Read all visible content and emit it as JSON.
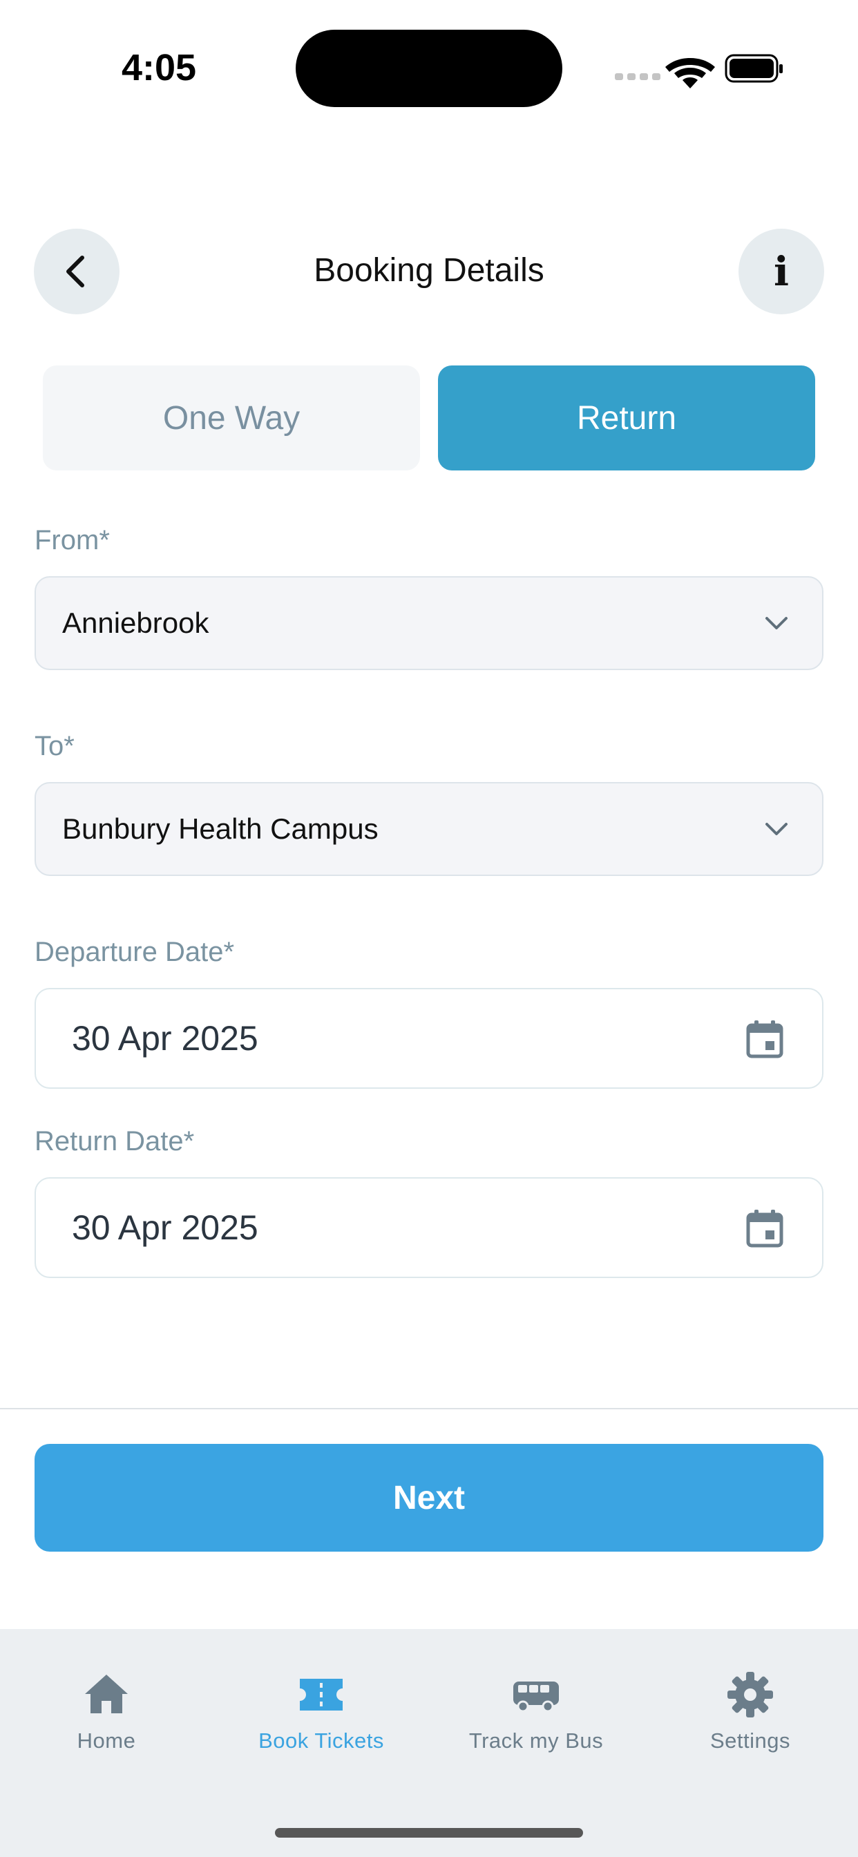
{
  "status_bar": {
    "time": "4:05"
  },
  "header": {
    "title": "Booking Details"
  },
  "trip_type": {
    "one_way_label": "One Way",
    "return_label": "Return",
    "selected": "Return"
  },
  "form": {
    "from_label": "From*",
    "from_value": "Anniebrook",
    "to_label": "To*",
    "to_value": "Bunbury Health Campus",
    "departure_label": "Departure Date*",
    "departure_value": "30 Apr 2025",
    "return_label": "Return Date*",
    "return_value": "30 Apr 2025"
  },
  "next_button": {
    "label": "Next"
  },
  "tabbar": {
    "items": [
      {
        "label": "Home",
        "icon": "home-icon"
      },
      {
        "label": "Book Tickets",
        "icon": "ticket-icon",
        "active": true
      },
      {
        "label": "Track my Bus",
        "icon": "bus-icon"
      },
      {
        "label": "Settings",
        "icon": "gear-icon"
      }
    ]
  },
  "colors": {
    "accent": "#3ba4e2",
    "segment_selected": "#35a0ca",
    "label": "#7a93a1",
    "tab_inactive": "#6b7d8a"
  }
}
